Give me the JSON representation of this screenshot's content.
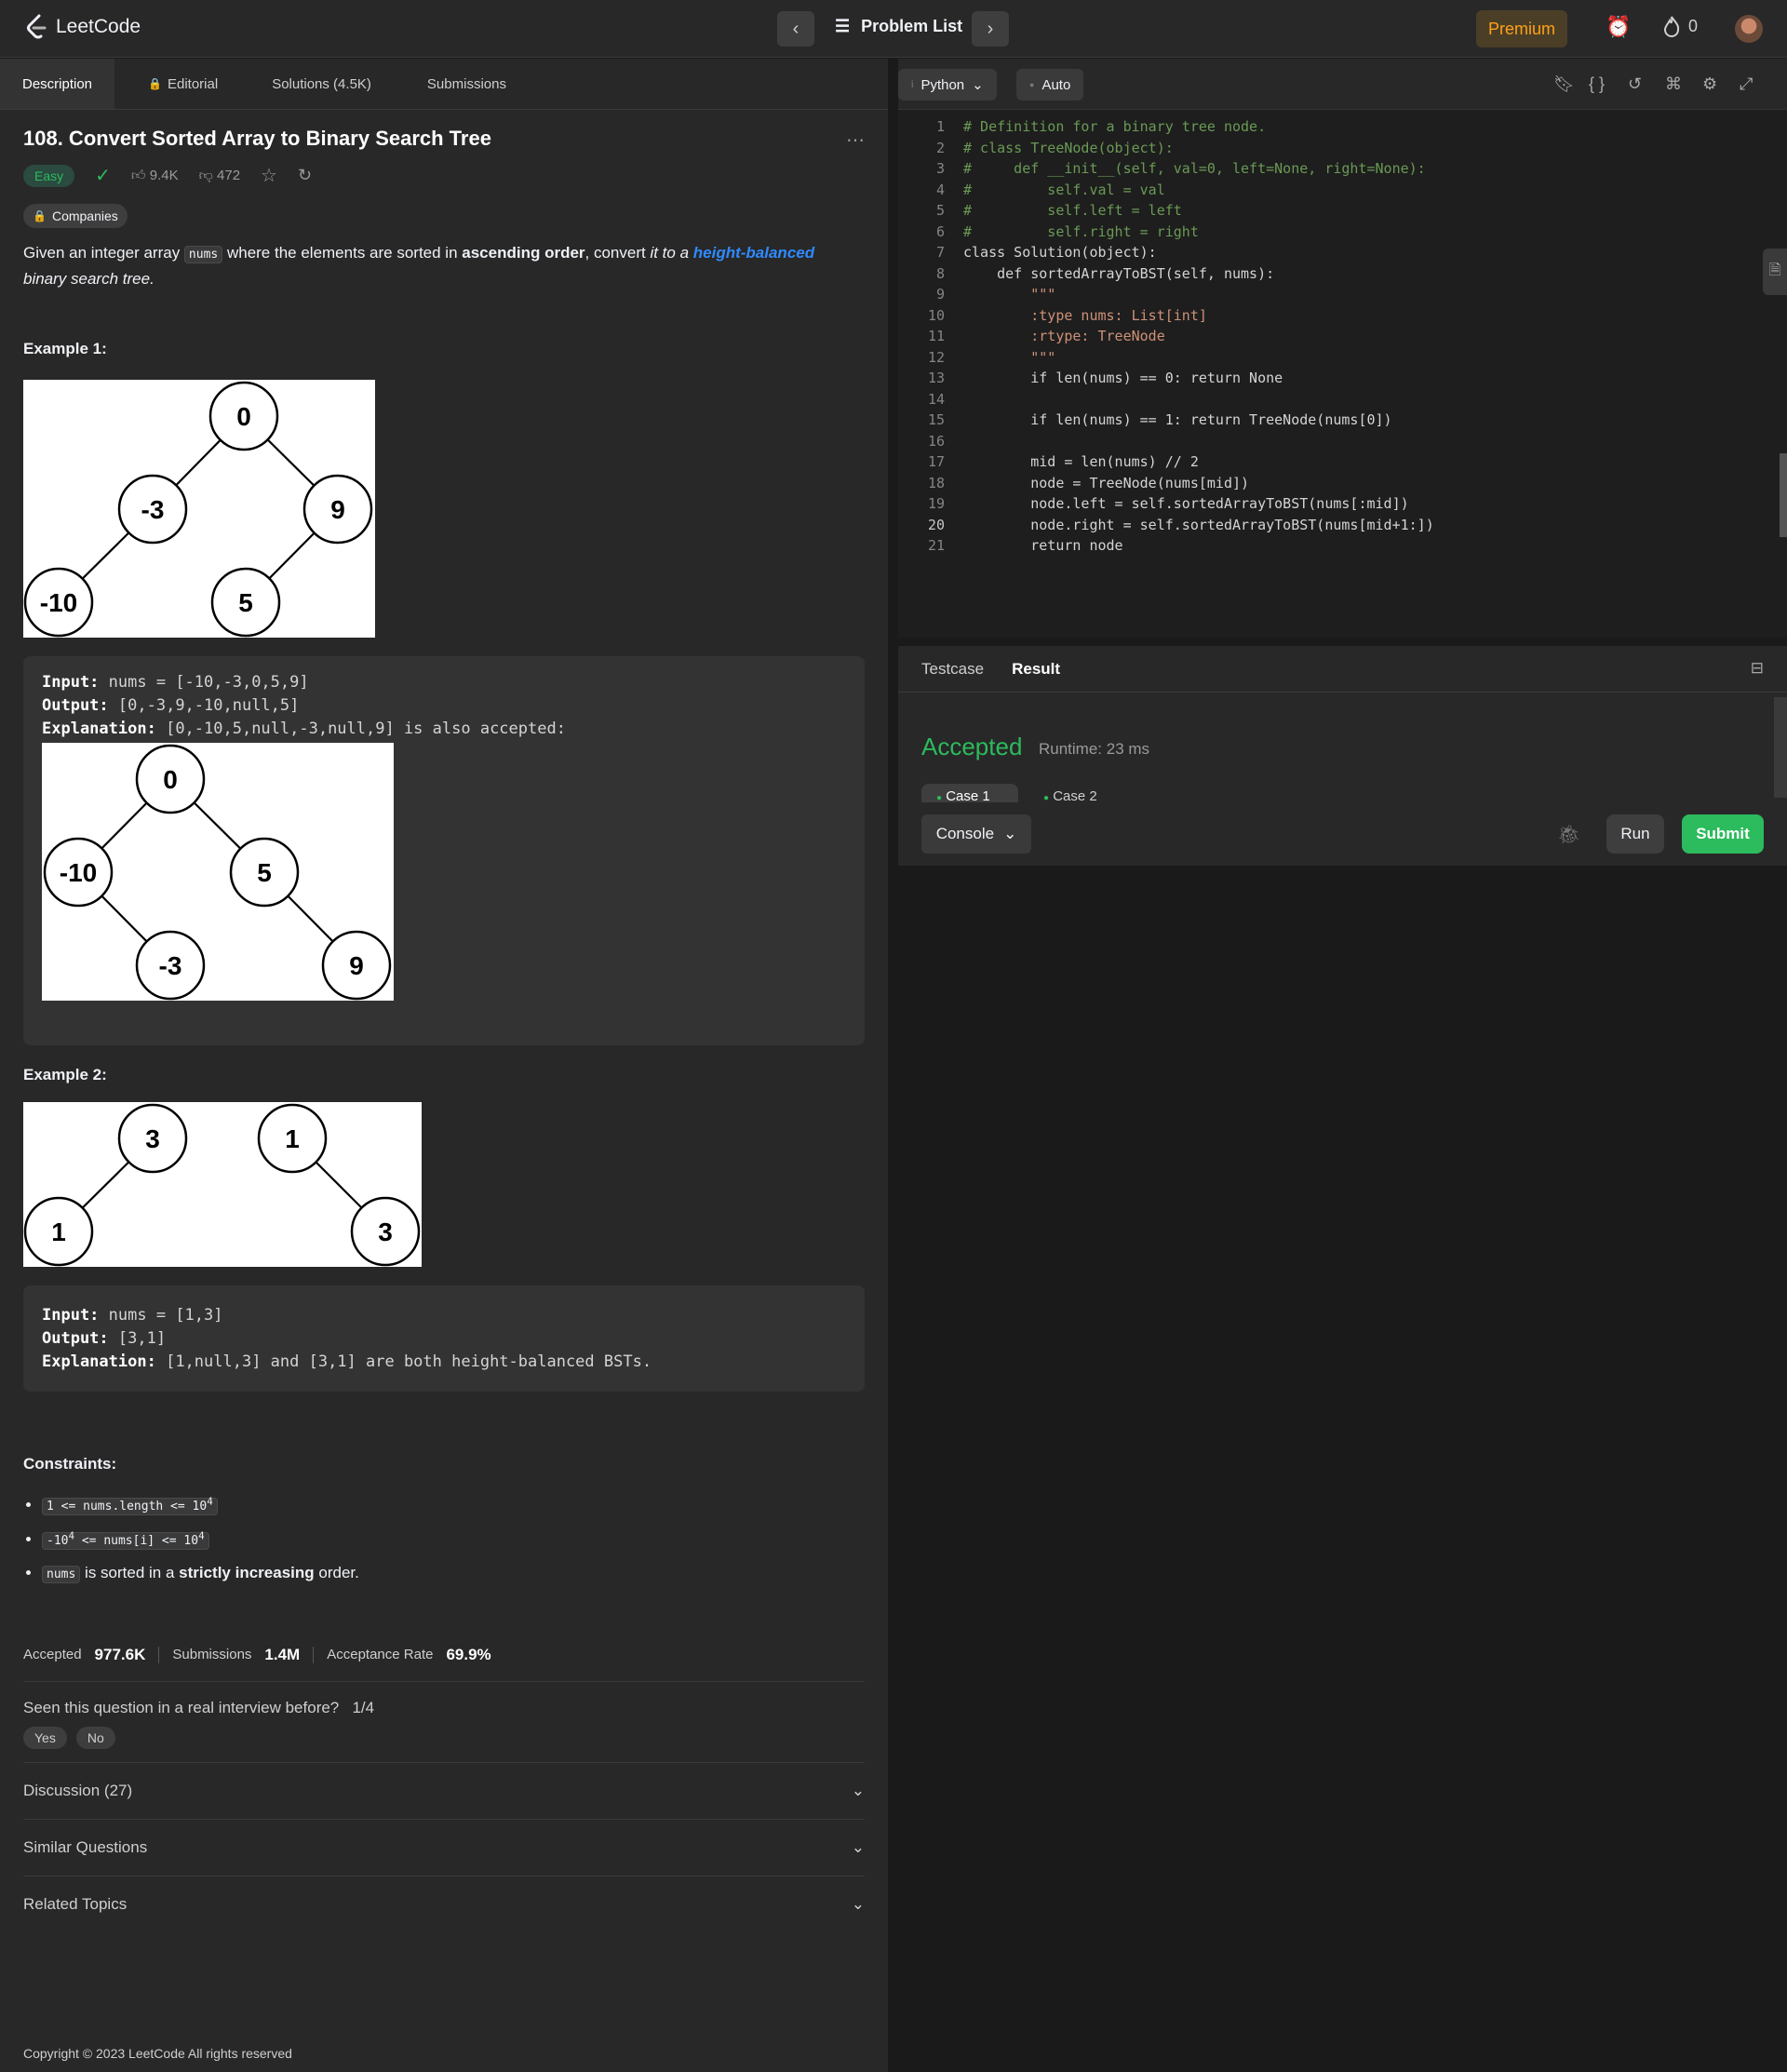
{
  "app": {
    "name": "LeetCode"
  },
  "topnav": {
    "problem_list": "Problem List",
    "premium": "Premium",
    "streak": "0"
  },
  "tabs": {
    "description": "Description",
    "editorial": "Editorial",
    "solutions": "Solutions (4.5K)",
    "submissions": "Submissions"
  },
  "problem": {
    "title": "108. Convert Sorted Array to Binary Search Tree",
    "difficulty": "Easy",
    "likes": "9.4K",
    "dislikes": "472",
    "companies": "Companies",
    "desc_1": "Given an integer array ",
    "desc_code": "nums",
    "desc_2": " where the elements are sorted in ",
    "desc_bold": "ascending order",
    "desc_3": ", convert ",
    "desc_it": "it to a ",
    "desc_link": "height-balanced",
    "desc_4": "binary search tree."
  },
  "examples": [
    {
      "heading": "Example 1:",
      "tree_a": [
        "0",
        "-3",
        "9",
        "-10",
        "5"
      ],
      "input_label": "Input:",
      "input": "nums = [-10,-3,0,5,9]",
      "output_label": "Output:",
      "output": "[0,-3,9,-10,null,5]",
      "explanation_label": "Explanation:",
      "explanation": "[0,-10,5,null,-3,null,9] is also accepted:",
      "tree_b": [
        "0",
        "-10",
        "5",
        "-3",
        "9"
      ]
    },
    {
      "heading": "Example 2:",
      "tree_a": [
        "3",
        "1"
      ],
      "tree_b": [
        "1",
        "3"
      ],
      "input_label": "Input:",
      "input": "nums = [1,3]",
      "output_label": "Output:",
      "output": "[3,1]",
      "explanation_label": "Explanation:",
      "explanation": "[1,null,3] and [3,1] are both height-balanced BSTs."
    }
  ],
  "constraints": {
    "heading": "Constraints:",
    "c1_a": "1 <= nums.length <= 10",
    "c1_sup": "4",
    "c2_a": "-10",
    "c2_sup1": "4",
    "c2_b": " <= nums[i] <= 10",
    "c2_sup2": "4",
    "c3_code": "nums",
    "c3_a": " is sorted in a ",
    "c3_bold": "strictly increasing",
    "c3_b": " order."
  },
  "stats": {
    "accepted_label": "Accepted",
    "accepted": "977.6K",
    "submissions_label": "Submissions",
    "submissions": "1.4M",
    "rate_label": "Acceptance Rate",
    "rate": "69.9%"
  },
  "interview": {
    "question": "Seen this question in a real interview before?",
    "progress": "1/4",
    "yes": "Yes",
    "no": "No"
  },
  "sections": {
    "discussion": "Discussion (27)",
    "similar": "Similar Questions",
    "topics": "Related Topics"
  },
  "footer": "Copyright © 2023 LeetCode All rights reserved",
  "editor": {
    "language": "Python",
    "mode": "Auto",
    "lines": [
      "# Definition for a binary tree node.",
      "# class TreeNode(object):",
      "#     def __init__(self, val=0, left=None, right=None):",
      "#         self.val = val",
      "#         self.left = left",
      "#         self.right = right",
      "class Solution(object):",
      "    def sortedArrayToBST(self, nums):",
      "        \"\"\"",
      "        :type nums: List[int]",
      "        :rtype: TreeNode",
      "        \"\"\"",
      "        if len(nums) == 0: return None",
      "",
      "        if len(nums) == 1: return TreeNode(nums[0])",
      "",
      "        mid = len(nums) // 2",
      "        node = TreeNode(nums[mid])",
      "        node.left = self.sortedArrayToBST(nums[:mid])",
      "        node.right = self.sortedArrayToBST(nums[mid+1:])",
      "        return node"
    ],
    "current_line": 20
  },
  "result": {
    "testcase_tab": "Testcase",
    "result_tab": "Result",
    "status": "Accepted",
    "runtime": "Runtime: 23 ms",
    "case1": "Case 1",
    "case2": "Case 2",
    "console": "Console",
    "run": "Run",
    "submit": "Submit"
  }
}
